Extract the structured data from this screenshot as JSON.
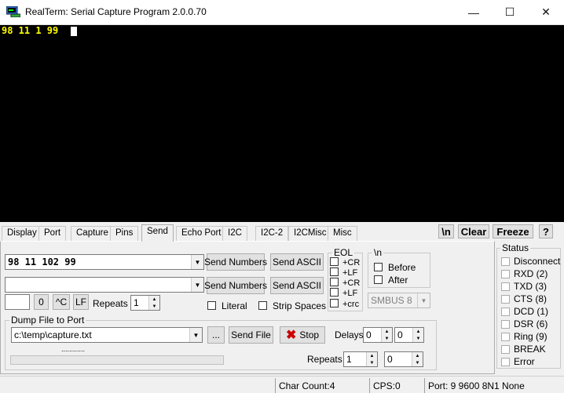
{
  "window": {
    "title": "RealTerm: Serial Capture Program 2.0.0.70",
    "minimize": "—",
    "maximize": "☐",
    "close": "✕"
  },
  "terminal": {
    "text": "98 11 1 99"
  },
  "tabs": [
    "Display",
    "Port",
    "Capture",
    "Pins",
    "Send",
    "Echo Port",
    "I2C",
    "I2C-2",
    "I2CMisc",
    "Misc"
  ],
  "active_tab": "Send",
  "toolbar": {
    "newline_label": "\\n",
    "clear_label": "Clear",
    "freeze_label": "Freeze",
    "help_label": "?"
  },
  "send": {
    "line1_value": "98 11 102 99",
    "line2_value": "",
    "send_numbers_label": "Send Numbers",
    "send_ascii_label": "Send ASCII",
    "char_value": "",
    "zero_label": "0",
    "ctrl_c_label": "^C",
    "lf_label": "LF",
    "repeats_label": "Repeats",
    "repeats_value": "1",
    "literal_label": "Literal",
    "strip_spaces_label": "Strip Spaces"
  },
  "eol": {
    "title": "EOL",
    "items": [
      "+CR",
      "+LF",
      "+CR",
      "+LF",
      "+crc"
    ]
  },
  "newline_group": {
    "title": "\\n",
    "before_label": "Before",
    "after_label": "After"
  },
  "smbus": {
    "value": "SMBUS 8"
  },
  "dump": {
    "title": "Dump File to Port",
    "file_value": "c:\\temp\\capture.txt",
    "browse_label": "...",
    "send_file_label": "Send File",
    "stop_label": "Stop",
    "delays_label": "Delays",
    "delay1_value": "0",
    "delay2_value": "0",
    "repeats_label": "Repeats",
    "repeats1_value": "1",
    "repeats2_value": "0",
    "progress_dots": "............",
    "progress_fraction": 0
  },
  "status": {
    "title": "Status",
    "items": [
      "Disconnect",
      "RXD (2)",
      "TXD (3)",
      "CTS (8)",
      "DCD (1)",
      "DSR (6)",
      "Ring (9)",
      "BREAK",
      "Error"
    ]
  },
  "statusbar": {
    "char_count": "Char Count:4",
    "cps": "CPS:0",
    "port": "Port: 9 9600 8N1 None"
  },
  "colors": {
    "terminal_bg": "#000000",
    "terminal_text": "#ffff00",
    "stop_icon": "#cc0000"
  }
}
